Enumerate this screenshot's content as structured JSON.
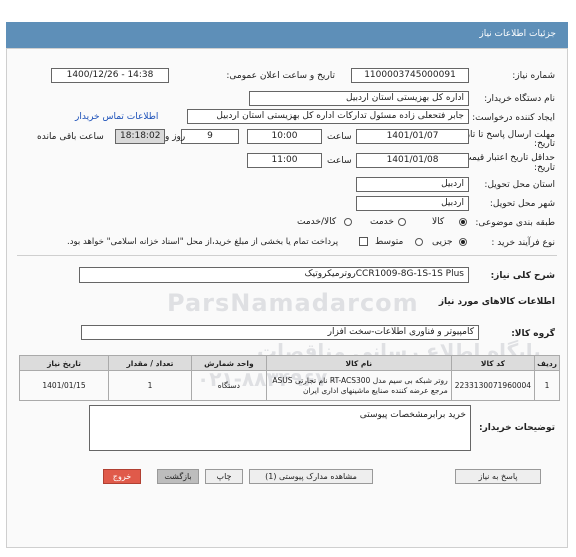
{
  "header": {
    "title": "جزئیات اطلاعات نیاز"
  },
  "need_number": {
    "label": "شماره نیاز:",
    "value": "1100003745000091"
  },
  "announce": {
    "label": "تاریخ و ساعت اعلان عمومی:",
    "value": "1400/12/26 - 14:38"
  },
  "buyer_org": {
    "label": "نام دستگاه خریدار:",
    "value": "اداره کل بهزیستی استان اردبیل"
  },
  "creator": {
    "label": "ایجاد کننده درخواست:",
    "value": "جابر فتحعلی زاده مسئول تدارکات اداره کل بهزیستی استان اردبیل",
    "contact_link": "اطلاعات تماس خریدار"
  },
  "deadline": {
    "label": "مهلت ارسال پاسخ تا تاریخ:",
    "date": "1401/01/07",
    "time_label": "ساعت",
    "time": "10:00",
    "days": "9",
    "days_label": "روز و",
    "remaining": "18:18:02",
    "remaining_label": "ساعت باقی مانده"
  },
  "validity": {
    "label": "حداقل تاریخ اعتبار قیمت تا تاریخ:",
    "date": "1401/01/08",
    "time_label": "ساعت",
    "time": "11:00"
  },
  "province": {
    "label": "استان محل تحویل:",
    "value": "اردبیل"
  },
  "city": {
    "label": "شهر محل تحویل:",
    "value": "اردبیل"
  },
  "category": {
    "label": "طبقه بندی موضوعی:",
    "options": [
      "کالا",
      "خدمت",
      "کالا/خدمت"
    ],
    "selected": "کالا"
  },
  "process": {
    "label": "نوع فرآیند خرید :",
    "options": [
      "جزیی",
      "متوسط"
    ],
    "selected": "جزیی",
    "payment_note": "پرداخت تمام یا بخشی از مبلغ خرید،از محل \"اسناد خزانه اسلامی\" خواهد بود."
  },
  "description": {
    "label": "شرح کلی نیاز:",
    "value": "روترمیکروتیکCCR1009-8G-1S-1S Plus"
  },
  "goods_section": {
    "title": "اطلاعات کالاهای مورد نیاز"
  },
  "goods_group": {
    "label": "گروه کالا:",
    "value": "کامپیوتر و فناوری اطلاعات-سخت افزار"
  },
  "table": {
    "headers": [
      "ردیف",
      "کد کالا",
      "نام کالا",
      "واحد شمارش",
      "تعداد / مقدار",
      "تاریخ نیاز"
    ],
    "rows": [
      [
        "1",
        "2233130071960004",
        "روتر شبکه بی سیم مدل RT-ACS300 نام تجارتی ASUS مرجع عرضه کننده صنایع ماشینهای اداری ایران",
        "دستگاه",
        "1",
        "1401/01/15"
      ]
    ]
  },
  "buyer_notes": {
    "label": "توضیحات خریدار:",
    "value": "خرید برابرمشخصات پیوستی"
  },
  "buttons": {
    "reply": "پاسخ به نیاز",
    "attachments": "مشاهده مدارک پیوستی (1)",
    "print": "چاپ",
    "back": "بازگشت",
    "exit": "خروج"
  },
  "watermark": {
    "brand": "ParsNamadarcom",
    "line1": "پایگاه اطلاع رسانی مناقصات",
    "line2": "۰۲۱-۸۸۳۴۹۶۷۰"
  }
}
